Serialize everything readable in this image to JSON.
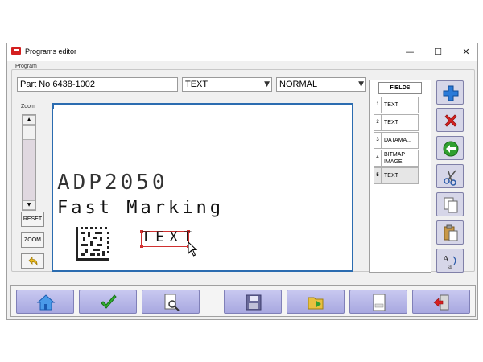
{
  "window": {
    "title": "Programs editor",
    "minimize": "—",
    "maximize": "☐",
    "close": "✕"
  },
  "program": {
    "group_label": "Program",
    "name_value": "Part No 6438-1002",
    "type_value": "TEXT",
    "mode_value": "NORMAL"
  },
  "zoom": {
    "label": "Zoom",
    "reset_label": "RESET",
    "zoom_label": "ZOOM"
  },
  "canvas": {
    "line1": "ADP2050",
    "line2": "Fast Marking",
    "line3": "TEXT"
  },
  "fields": {
    "header": "FIELDS",
    "items": [
      {
        "num": "1",
        "label": "TEXT"
      },
      {
        "num": "2",
        "label": "TEXT"
      },
      {
        "num": "3",
        "label": "DATAMA..."
      },
      {
        "num": "4",
        "label": "BITMAP IMAGE"
      },
      {
        "num": "5",
        "label": "TEXT"
      }
    ],
    "selected_index": 5
  },
  "toolbar_icons": [
    "add-icon",
    "delete-icon",
    "back-arrow-icon",
    "cut-icon",
    "copy-icon",
    "paste-icon",
    "font-icon"
  ],
  "bottom_icons": [
    "home-icon",
    "checkmark-icon",
    "preview-icon",
    "save-icon",
    "open-folder-icon",
    "new-document-icon",
    "exit-icon"
  ],
  "colors": {
    "canvas_border": "#2b6cb0",
    "selection": "#d03030",
    "button_face": "#b8b8ea"
  }
}
